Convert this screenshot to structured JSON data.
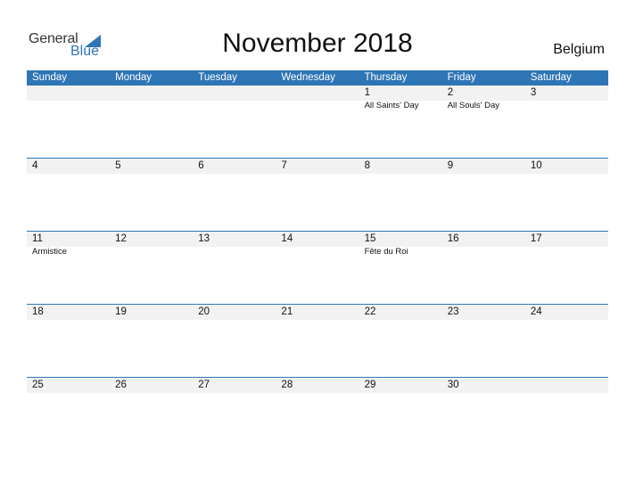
{
  "logo": {
    "general": "General",
    "blue": "Blue"
  },
  "title": "November 2018",
  "country": "Belgium",
  "colors": {
    "accent": "#2e75b6",
    "band": "#f2f2f2"
  },
  "weekdays": [
    "Sunday",
    "Monday",
    "Tuesday",
    "Wednesday",
    "Thursday",
    "Friday",
    "Saturday"
  ],
  "weeks": [
    [
      {
        "day": "",
        "holiday": ""
      },
      {
        "day": "",
        "holiday": ""
      },
      {
        "day": "",
        "holiday": ""
      },
      {
        "day": "",
        "holiday": ""
      },
      {
        "day": "1",
        "holiday": "All Saints' Day"
      },
      {
        "day": "2",
        "holiday": "All Souls' Day"
      },
      {
        "day": "3",
        "holiday": ""
      }
    ],
    [
      {
        "day": "4",
        "holiday": ""
      },
      {
        "day": "5",
        "holiday": ""
      },
      {
        "day": "6",
        "holiday": ""
      },
      {
        "day": "7",
        "holiday": ""
      },
      {
        "day": "8",
        "holiday": ""
      },
      {
        "day": "9",
        "holiday": ""
      },
      {
        "day": "10",
        "holiday": ""
      }
    ],
    [
      {
        "day": "11",
        "holiday": "Armistice"
      },
      {
        "day": "12",
        "holiday": ""
      },
      {
        "day": "13",
        "holiday": ""
      },
      {
        "day": "14",
        "holiday": ""
      },
      {
        "day": "15",
        "holiday": "Fête du Roi"
      },
      {
        "day": "16",
        "holiday": ""
      },
      {
        "day": "17",
        "holiday": ""
      }
    ],
    [
      {
        "day": "18",
        "holiday": ""
      },
      {
        "day": "19",
        "holiday": ""
      },
      {
        "day": "20",
        "holiday": ""
      },
      {
        "day": "21",
        "holiday": ""
      },
      {
        "day": "22",
        "holiday": ""
      },
      {
        "day": "23",
        "holiday": ""
      },
      {
        "day": "24",
        "holiday": ""
      }
    ],
    [
      {
        "day": "25",
        "holiday": ""
      },
      {
        "day": "26",
        "holiday": ""
      },
      {
        "day": "27",
        "holiday": ""
      },
      {
        "day": "28",
        "holiday": ""
      },
      {
        "day": "29",
        "holiday": ""
      },
      {
        "day": "30",
        "holiday": ""
      },
      {
        "day": "",
        "holiday": ""
      }
    ]
  ]
}
